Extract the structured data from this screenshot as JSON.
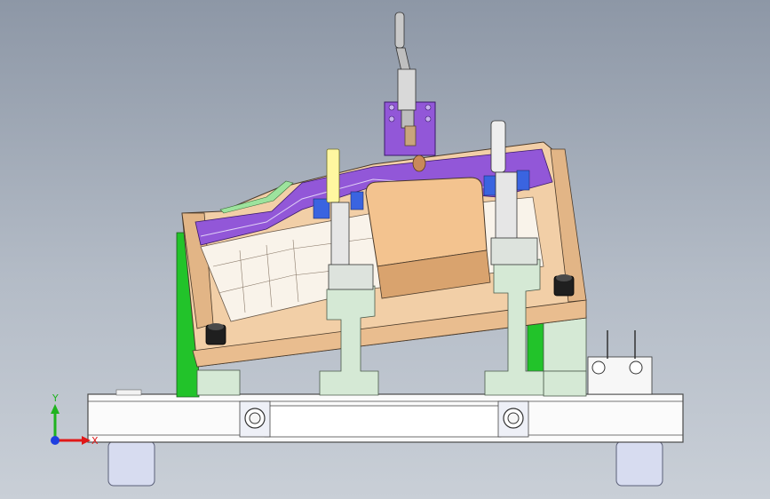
{
  "viewport": {
    "background_top": "#8d97a6",
    "background_bottom": "#c9cfd7"
  },
  "triad": {
    "x_label": "X",
    "y_label": "Y",
    "x_color": "#e01818",
    "y_color": "#1fb31f",
    "z_color": "#1f3fe0"
  },
  "colors": {
    "base_plate": "#fbfbfb",
    "pads": "#d5e9d5",
    "support_green": "#22c32a",
    "fixture_tan": "#f2cfa7",
    "purple": "#9257d8",
    "blue_pads": "#3a64e0",
    "feet": "#d7dcf0"
  },
  "icons": {
    "triad": "coordinate-triad-icon"
  }
}
